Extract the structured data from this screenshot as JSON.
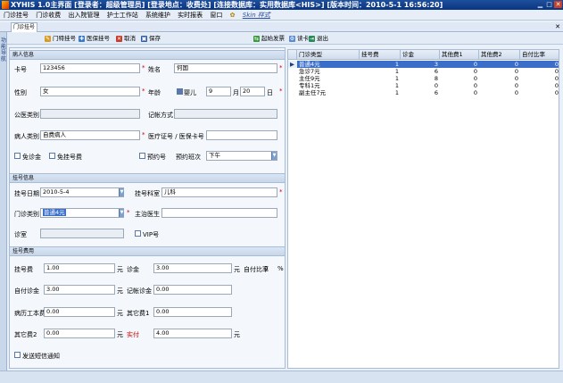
{
  "title": {
    "app": "XYHIS 1.0主界面",
    "user": "[登录者：超级管理员]",
    "site": "[登录地点：收费处]",
    "db": "[连接数据库：实用数据库<HIS>]",
    "version": "[版本时间：2010-5-1 16:56:20]"
  },
  "menu": {
    "items": [
      "门诊挂号",
      "门诊收费",
      "出入院管理",
      "护士工作站",
      "系统维护",
      "实时报表",
      "窗口"
    ],
    "ver_link": "Skin 样式"
  },
  "tab": {
    "label": "门诊挂号"
  },
  "side": {
    "label": "功能导航"
  },
  "toolbar": {
    "btn1": "门特挂号",
    "btn2": "医保挂号",
    "btn3": "取消",
    "btn4": "保存",
    "btn5": "起始发票",
    "btn6": "读卡",
    "btn7": "退出"
  },
  "patient": {
    "section": "病人信息",
    "card_label": "卡号",
    "card_value": "123456",
    "name_label": "姓名",
    "name_value": "何国",
    "sex_label": "性别",
    "sex_value": "女",
    "age_label": "年龄",
    "infant_label": "婴儿",
    "age_year": "9",
    "month_label": "月",
    "age_day": "20",
    "day_label": "日",
    "company_label": "公医类别",
    "account_label": "记帐方式",
    "pt_type_label": "病人类别",
    "pt_type_value": "自费病人",
    "card2_label": "医疗证号 / 医保卡号",
    "free_label": "免诊金",
    "free_fee_label": "免挂号费",
    "book_label": "预约号",
    "book_shift_label": "预约班次",
    "book_shift_value": "下午"
  },
  "register": {
    "section": "挂号信息",
    "date_label": "挂号日期",
    "date_value": "2010-5-4",
    "dept_label": "挂号科室",
    "dept_value": "儿科",
    "type_label": "门诊类别",
    "type_value": "普通4元",
    "doctor_label": "主治医生",
    "room_label": "诊室",
    "vip_label": "VIP号"
  },
  "fee": {
    "section": "挂号费用",
    "reg_fee_label": "挂号费",
    "reg_fee_value": "1.00",
    "unit": "元",
    "consult_label": "诊金",
    "consult_value": "3.00",
    "selfpay_label": "自付比率",
    "selfpay_value": "0",
    "percent": "%",
    "self_consult_label": "自付诊金",
    "self_consult_value": "3.00",
    "acct_consult_label": "记帐诊金",
    "acct_consult_value": "0.00",
    "record_label": "病历工本费",
    "record_value": "0.00",
    "other1_label": "其它费1",
    "other1_value": "0.00",
    "other2_label": "其它费2",
    "other2_value": "0.00",
    "paid_label": "实付",
    "paid_value": "4.00",
    "sms_label": "发送短信通知"
  },
  "grid": {
    "headers": [
      "门诊类型",
      "挂号费",
      "诊金",
      "其他费1",
      "其他费2",
      "自付比率"
    ],
    "rows": [
      [
        "普通4元",
        "1",
        "3",
        "0",
        "0",
        "0"
      ],
      [
        "急诊7元",
        "1",
        "6",
        "0",
        "0",
        "0"
      ],
      [
        "主任9元",
        "1",
        "8",
        "0",
        "0",
        "0"
      ],
      [
        "专科1元",
        "1",
        "0",
        "0",
        "0",
        "0"
      ],
      [
        "副主任7元",
        "1",
        "6",
        "0",
        "0",
        "0"
      ]
    ]
  },
  "colors": {
    "title_bg": "#0a3580",
    "selected_row": "#3a6ec8",
    "required": "#d00000"
  }
}
